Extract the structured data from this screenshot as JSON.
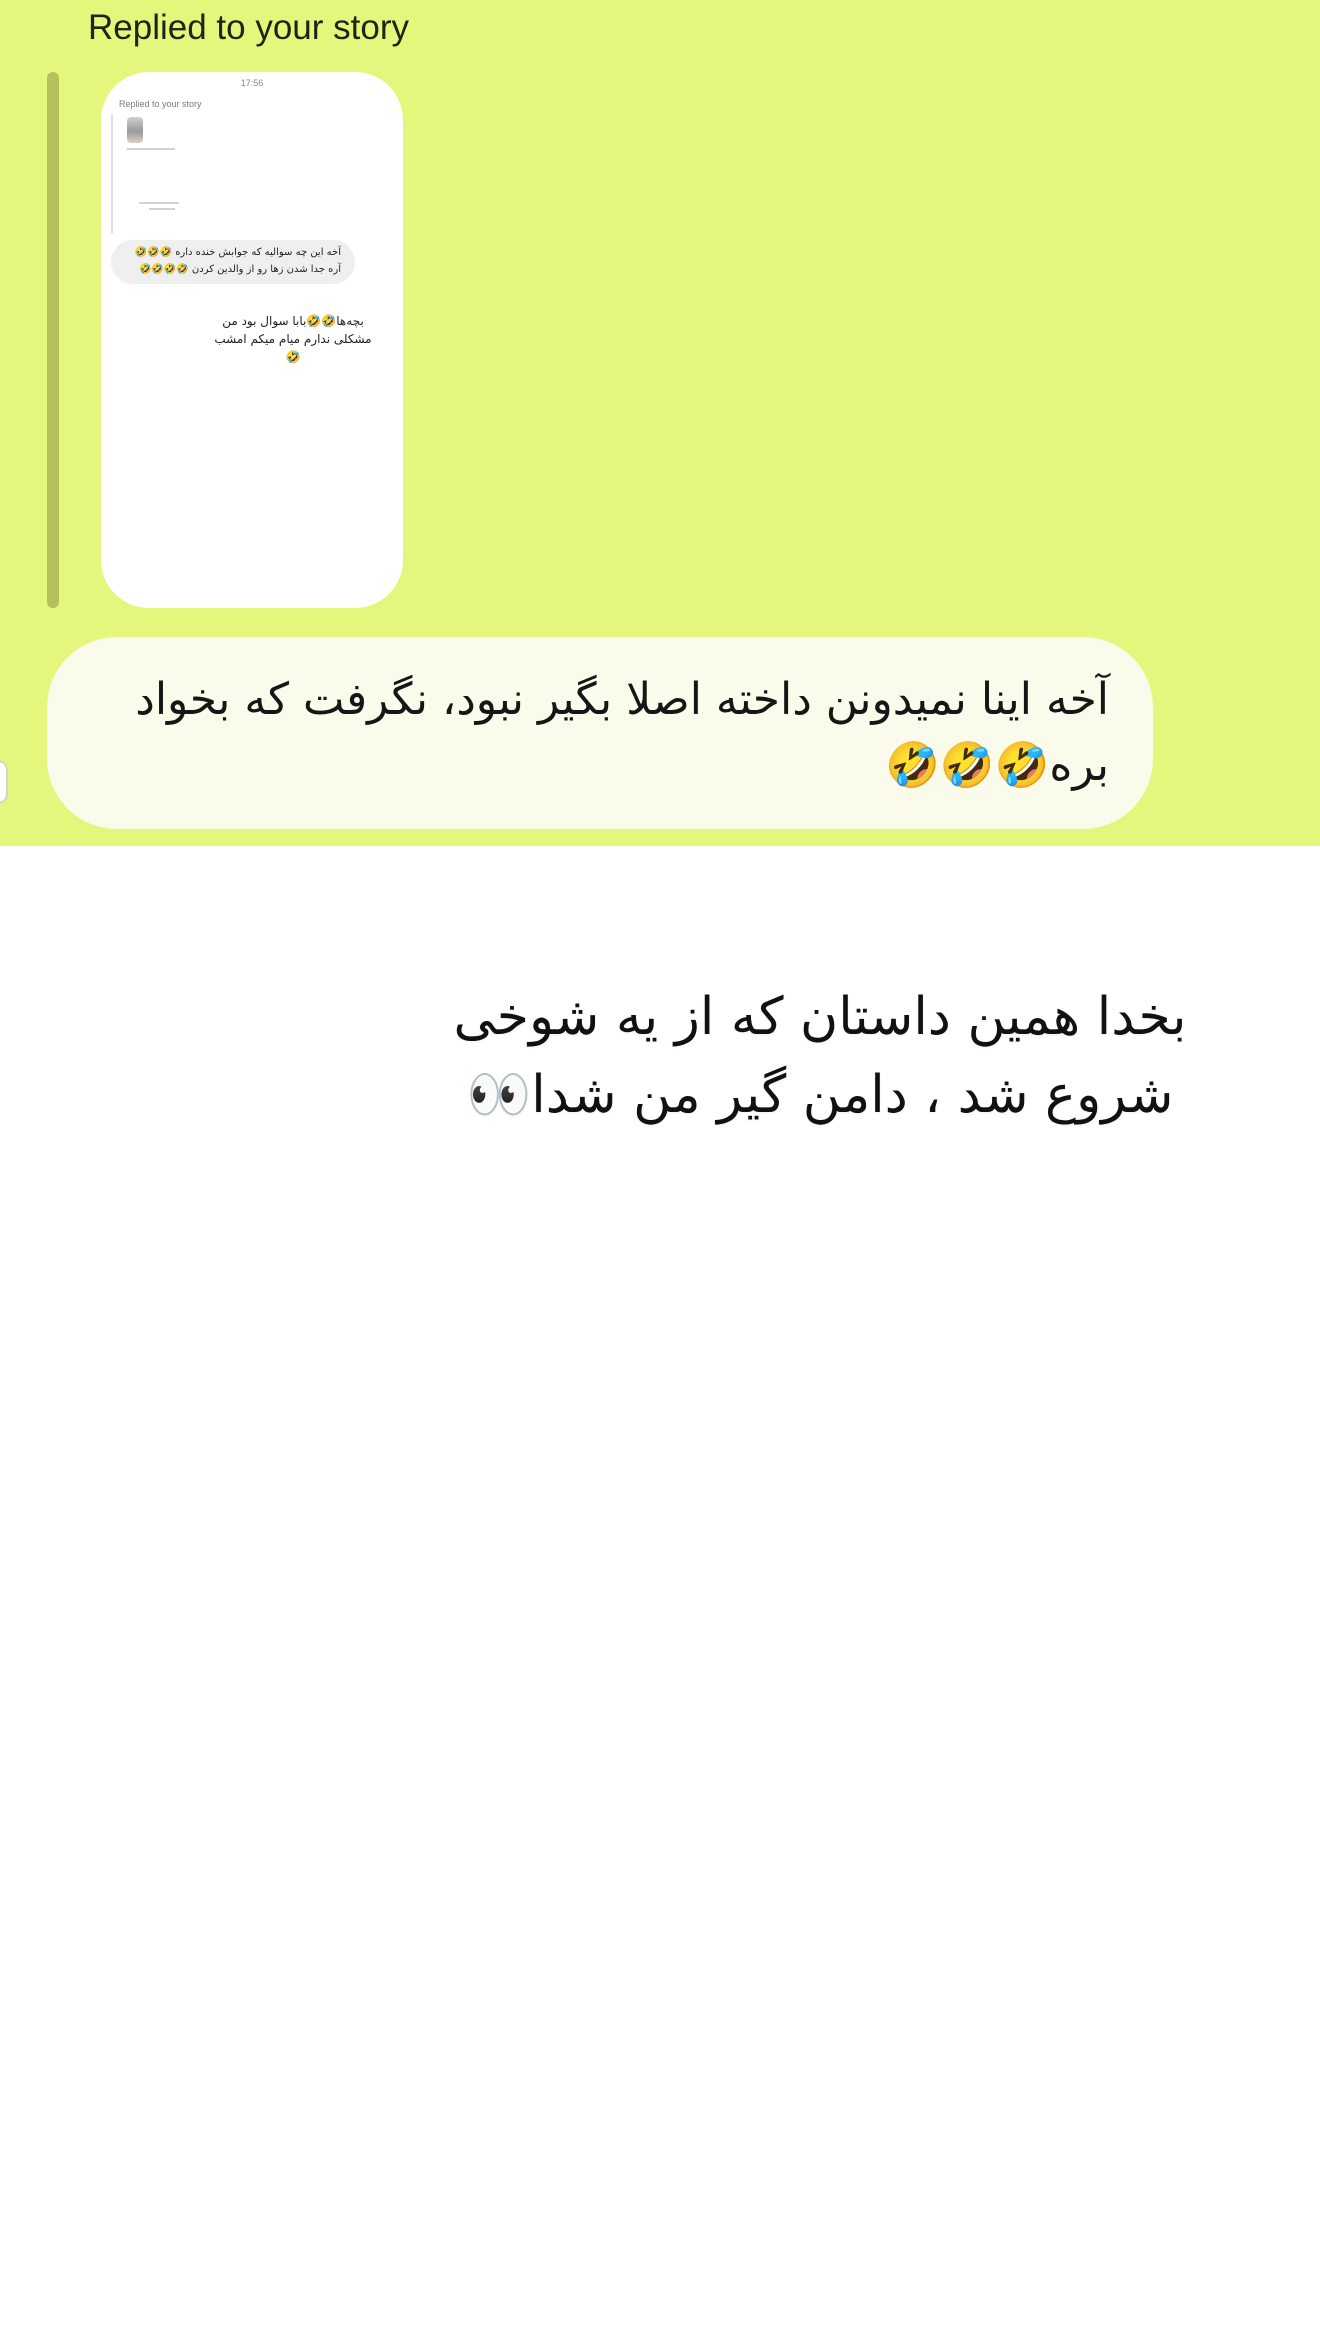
{
  "chat": {
    "reply_header": "Replied to your story",
    "story_preview": {
      "time": "17:56",
      "replied_label": "Replied to your story",
      "quoted_message": "آخه این چه سوالیه که جوابش خنده داره 🤣🤣🤣 آره جدا شدن زها رو از والدین کردن 🤣🤣🤣🤣",
      "reply_message": "بچه‌ها🤣🤣بابا سوال بود من مشکلی ندارم میام میکم امشب🤣"
    },
    "message_text": "آخه اینا نمیدونن داخته اصلا بگیر نبود، نگرفت که بخواد بره🤣🤣🤣"
  },
  "caption_text": "بخدا همین داستان که از یه شوخی شروع شد ، دامن گیر من شدا👀",
  "colors": {
    "chat_background": "#e4f67b",
    "bubble_background": "#fbfbec",
    "reply_bar": "#b4c05a",
    "page_background": "#ffffff"
  }
}
